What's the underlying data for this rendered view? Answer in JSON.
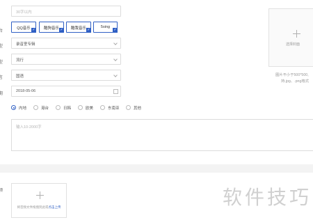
{
  "form": {
    "name_field": {
      "placeholder": "30字以内"
    },
    "platforms": [
      {
        "label": "QQ音乐",
        "checked": true
      },
      {
        "label": "酷狗音乐",
        "checked": true
      },
      {
        "label": "酷我音乐",
        "checked": true
      },
      {
        "label": "5sing",
        "checked": true
      }
    ],
    "album_type": {
      "value": "录音室专辑"
    },
    "genre": {
      "value": "流行"
    },
    "language": {
      "value": "国语"
    },
    "release_date": {
      "value": "2018-05-06"
    },
    "region_options": [
      {
        "label": "内地",
        "selected": true
      },
      {
        "label": "港台",
        "selected": false
      },
      {
        "label": "日韩",
        "selected": false
      },
      {
        "label": "欧美",
        "selected": false
      },
      {
        "label": "东南亚",
        "selected": false
      },
      {
        "label": "其他",
        "selected": false
      }
    ],
    "intro": {
      "placeholder": "输入10-2000字"
    }
  },
  "cover": {
    "upload_label": "选择封面",
    "hint_line1": "图片不小于500*500,",
    "hint_line2": "持.jpg、.png格式"
  },
  "audio_upload": {
    "text": "将音频文件拖拽到此或",
    "link": "点击上传"
  },
  "watermark": {
    "text": "软件技巧"
  },
  "colors": {
    "accent": "#2f5fc4",
    "border": "#dcdcdc",
    "placeholder": "#b5b5b5"
  }
}
